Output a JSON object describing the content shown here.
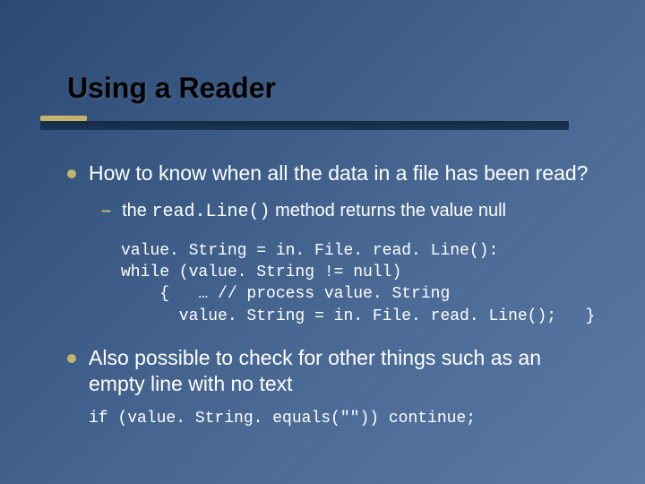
{
  "title": "Using a Reader",
  "bullets": [
    {
      "text": "How to know when all the data in a file has been read?",
      "sub": [
        {
          "pre": "the ",
          "code": "read.Line()",
          "post": " method returns the value null"
        }
      ]
    },
    {
      "text": "Also possible to check for other things such as an empty line with no text"
    }
  ],
  "code1": "value. String = in. File. read. Line():\nwhile (value. String != null)\n    {   … // process value. String\n      value. String = in. File. read. Line();   }",
  "code2": "if (value. String. equals(\"\")) continue;",
  "colors": {
    "accent": "#c5b56a",
    "bg_start": "#2a4a72",
    "bg_end": "#5a7aa5",
    "title_text": "#000000",
    "body_text": "#ffffff"
  }
}
